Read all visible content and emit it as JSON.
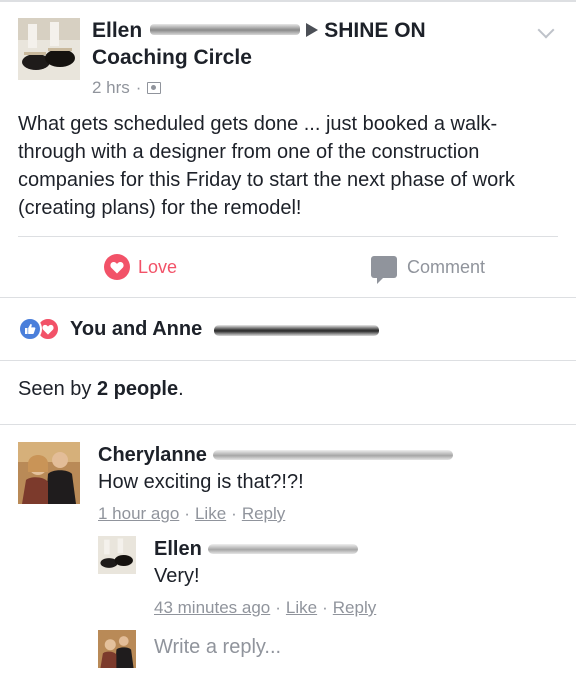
{
  "post": {
    "author": "Ellen",
    "group_name_right": "SHINE ON",
    "group_name_line2": "Coaching Circle",
    "time": "2 hrs",
    "separator": "·",
    "body": "What gets scheduled gets done ... just booked a walk-through with a designer from one of the construction companies for this Friday to start the next phase of work (creating plans) for the remodel!"
  },
  "actions": {
    "love_label": "Love",
    "comment_label": "Comment"
  },
  "reactions": {
    "text": "You and Anne"
  },
  "seen": {
    "prefix": "Seen by ",
    "count": "2 people",
    "suffix": "."
  },
  "comments": [
    {
      "author": "Cherylanne",
      "text": "How exciting is that?!?!",
      "time": "1 hour ago",
      "like": "Like",
      "reply": "Reply"
    },
    {
      "author": "Ellen",
      "text": "Very!",
      "time": "43 minutes ago",
      "like": "Like",
      "reply": "Reply"
    }
  ],
  "reply_box": {
    "placeholder": "Write a reply..."
  },
  "colors": {
    "love": "#f25268",
    "like": "#4a7fdb",
    "muted": "#90949c",
    "text": "#1d2129",
    "divider": "#dddfe2"
  },
  "icons": [
    "chevron-down-icon",
    "group-privacy-icon",
    "heart-icon",
    "comment-bubble-icon",
    "like-reaction-icon",
    "love-reaction-icon"
  ]
}
